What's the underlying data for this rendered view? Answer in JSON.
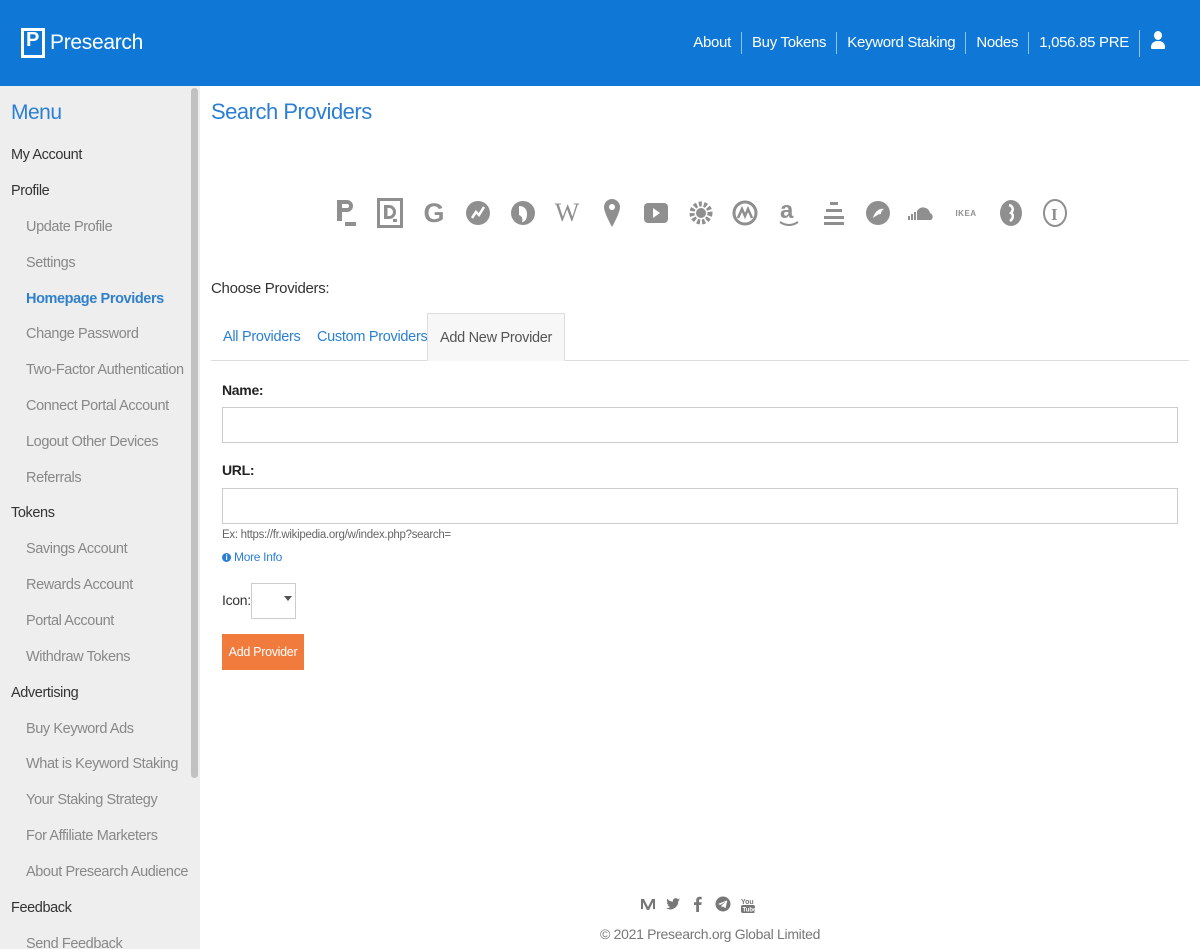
{
  "brand": {
    "name": "Presearch"
  },
  "nav": {
    "about": "About",
    "buy_tokens": "Buy Tokens",
    "keyword_staking": "Keyword Staking",
    "nodes": "Nodes",
    "balance": "1,056.85 PRE"
  },
  "sidebar": {
    "title": "Menu",
    "items": [
      {
        "label": "My Account",
        "level": "top"
      },
      {
        "label": "Profile",
        "level": "top"
      },
      {
        "label": "Update Profile",
        "level": "sub"
      },
      {
        "label": "Settings",
        "level": "sub"
      },
      {
        "label": "Homepage Providers",
        "level": "sub",
        "active": true
      },
      {
        "label": "Change Password",
        "level": "sub"
      },
      {
        "label": "Two-Factor Authentication",
        "level": "sub"
      },
      {
        "label": "Connect Portal Account",
        "level": "sub"
      },
      {
        "label": "Logout Other Devices",
        "level": "sub"
      },
      {
        "label": "Referrals",
        "level": "sub"
      },
      {
        "label": "Tokens",
        "level": "top"
      },
      {
        "label": "Savings Account",
        "level": "sub"
      },
      {
        "label": "Rewards Account",
        "level": "sub"
      },
      {
        "label": "Portal Account",
        "level": "sub"
      },
      {
        "label": "Withdraw Tokens",
        "level": "sub"
      },
      {
        "label": "Advertising",
        "level": "top"
      },
      {
        "label": "Buy Keyword Ads",
        "level": "sub"
      },
      {
        "label": "What is Keyword Staking",
        "level": "sub"
      },
      {
        "label": "Your Staking Strategy",
        "level": "sub"
      },
      {
        "label": "For Affiliate Marketers",
        "level": "sub"
      },
      {
        "label": "About Presearch Audience",
        "level": "sub"
      },
      {
        "label": "Feedback",
        "level": "top"
      },
      {
        "label": "Send Feedback",
        "level": "sub"
      }
    ]
  },
  "main": {
    "title": "Search Providers",
    "providers": [
      "presearch",
      "duckduckgo",
      "google",
      "coinmarketcap-like",
      "duckduckgo-alt",
      "wikipedia",
      "maps",
      "youtube",
      "gear",
      "coinmarketcap",
      "amazon",
      "stack",
      "etherscan",
      "soundcloud",
      "ikea",
      "twitch",
      "bracket"
    ],
    "provider_text": {
      "ikea": "IKEA",
      "wikipedia": "W",
      "google": "G"
    },
    "choose_label": "Choose Providers:",
    "tabs": [
      "All Providers",
      "Custom Providers",
      "Add New Provider"
    ],
    "form": {
      "name_label": "Name:",
      "name_value": "",
      "url_label": "URL:",
      "url_value": "",
      "url_hint": "Ex: https://fr.wikipedia.org/w/index.php?search=",
      "more_info": "More Info",
      "icon_label": "Icon:",
      "submit": "Add Provider"
    }
  },
  "footer": {
    "social": [
      "medium-icon",
      "twitter-icon",
      "facebook-icon",
      "telegram-icon",
      "youtube-icon"
    ],
    "copyright": "© 2021 Presearch.org Global Limited"
  },
  "colors": {
    "header": "#0f77d6",
    "accent": "#2a7fd4",
    "button": "#f07b3d"
  }
}
